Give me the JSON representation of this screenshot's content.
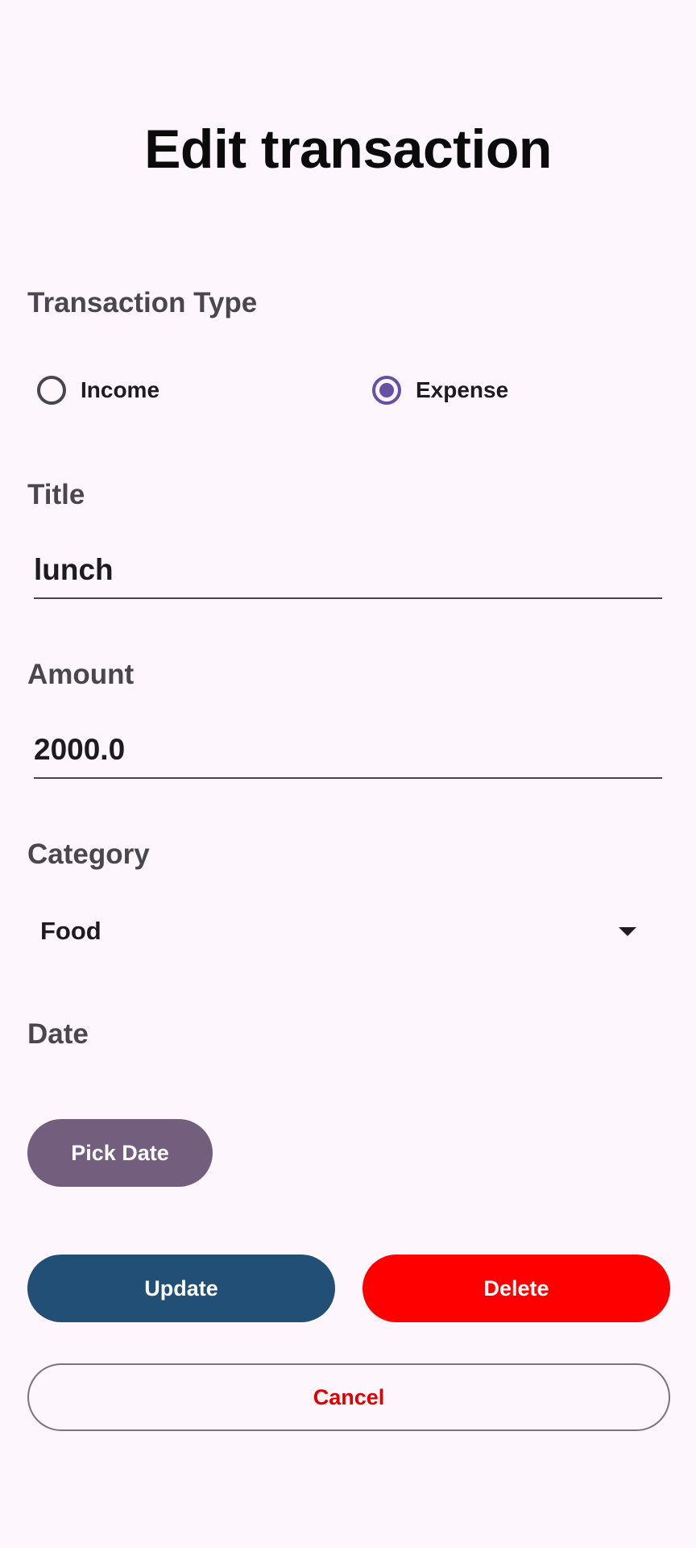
{
  "header": {
    "title": "Edit transaction"
  },
  "form": {
    "type_label": "Transaction Type",
    "type_options": [
      {
        "label": "Income",
        "selected": false
      },
      {
        "label": "Expense",
        "selected": true
      }
    ],
    "title_label": "Title",
    "title_value": "lunch",
    "amount_label": "Amount",
    "amount_value": "2000.0",
    "category_label": "Category",
    "category_value": "Food",
    "date_label": "Date"
  },
  "actions": {
    "pick_date": "Pick Date",
    "update": "Update",
    "delete": "Delete",
    "cancel": "Cancel"
  },
  "colors": {
    "background": "#fdf6fc",
    "radio_accent": "#6750a4",
    "pick_date_button": "#735e7e",
    "update_button": "#224f76",
    "delete_button": "#ff0000",
    "cancel_text": "#e00000"
  }
}
